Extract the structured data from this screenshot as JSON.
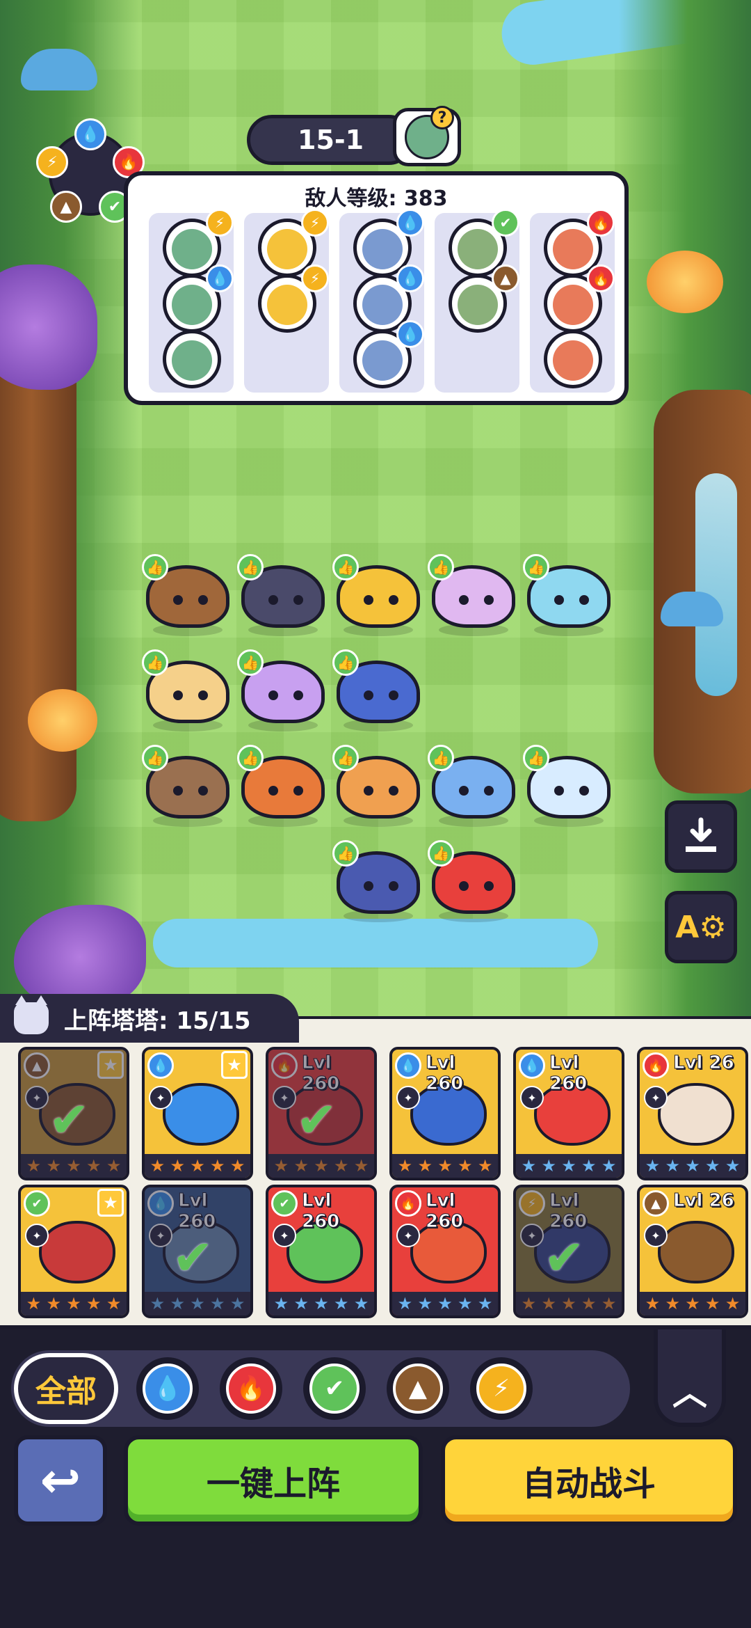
{
  "stage": {
    "label": "15-1",
    "boss_icon": "zombie-question-icon"
  },
  "enemy_panel": {
    "title": "敌人等级: 383",
    "columns": [
      {
        "enemies": [
          {
            "element": "lightning",
            "color": "#f5b21e"
          },
          {
            "element": "water",
            "color": "#3a8ee8"
          },
          {
            "element": "none",
            "color": ""
          }
        ]
      },
      {
        "enemies": [
          {
            "element": "lightning",
            "color": "#f5b21e"
          },
          {
            "element": "lightning",
            "color": "#f5b21e"
          }
        ]
      },
      {
        "enemies": [
          {
            "element": "water",
            "color": "#3a8ee8"
          },
          {
            "element": "water",
            "color": "#3a8ee8"
          },
          {
            "element": "water",
            "color": "#3a8ee8"
          }
        ]
      },
      {
        "enemies": [
          {
            "element": "leaf",
            "color": "#5fc25a"
          },
          {
            "element": "earth",
            "color": "#8a5a2e"
          }
        ]
      },
      {
        "enemies": [
          {
            "element": "fire",
            "color": "#e8363c"
          },
          {
            "element": "fire",
            "color": "#e8363c"
          },
          {
            "element": "none",
            "color": ""
          }
        ]
      }
    ]
  },
  "element_wheel": [
    "water",
    "fire",
    "leaf",
    "earth",
    "lightning"
  ],
  "team_creatures": [
    {
      "name": "shell-tortoise",
      "color": "#a0673a",
      "row": 0,
      "col": 0
    },
    {
      "name": "dino-lizard",
      "color": "#4a4a6a",
      "row": 0,
      "col": 1
    },
    {
      "name": "spiky-lion",
      "color": "#f5c23a",
      "row": 0,
      "col": 2
    },
    {
      "name": "flower-fairy",
      "color": "#e0b8f0",
      "row": 0,
      "col": 3
    },
    {
      "name": "crystal-crab",
      "color": "#8fd8f0",
      "row": 0,
      "col": 4
    },
    {
      "name": "fluffy-dog",
      "color": "#f5d08a",
      "row": 1,
      "col": 0
    },
    {
      "name": "purple-fox",
      "color": "#c8a0f0",
      "row": 1,
      "col": 1
    },
    {
      "name": "flame-fox",
      "color": "#4a6ad0",
      "row": 1,
      "col": 2
    },
    {
      "name": "goggle-ferret",
      "color": "#9a7050",
      "row": 2,
      "col": 0
    },
    {
      "name": "fire-snake",
      "color": "#e87a3a",
      "row": 2,
      "col": 1
    },
    {
      "name": "orange-fox",
      "color": "#f0a050",
      "row": 2,
      "col": 2
    },
    {
      "name": "butterfly-fairy",
      "color": "#7ab0f0",
      "row": 2,
      "col": 3
    },
    {
      "name": "ice-beast",
      "color": "#d8ecff",
      "row": 2,
      "col": 4
    },
    {
      "name": "storm-whale",
      "color": "#4a5ab0",
      "row": 3,
      "col": 2
    },
    {
      "name": "red-dragon",
      "color": "#e8403c",
      "row": 3,
      "col": 3
    }
  ],
  "side_tools": {
    "save_icon": "download-icon",
    "auto_icon": "auto-settings-icon",
    "auto_label": "A⚙"
  },
  "team_header": {
    "label": "上阵塔塔: 15/15"
  },
  "cards": [
    {
      "row": 0,
      "col": 0,
      "bg": "#c89a3a",
      "art": "#8a5a2e",
      "element": "earth",
      "elem_color": "#8a5a2e",
      "elem_glyph": "▲",
      "level": "",
      "fav": true,
      "selected": true,
      "stars": "orange"
    },
    {
      "row": 0,
      "col": 1,
      "bg": "#f5c23a",
      "art": "#3a8ee8",
      "element": "water",
      "elem_color": "#3a8ee8",
      "elem_glyph": "💧",
      "level": "",
      "fav": true,
      "selected": false,
      "stars": "orange"
    },
    {
      "row": 0,
      "col": 2,
      "bg": "#e8403c",
      "art": "#c83a3a",
      "element": "fire",
      "elem_color": "#e8363c",
      "elem_glyph": "🔥",
      "level": "Lvl 260",
      "fav": false,
      "selected": true,
      "stars": "orange"
    },
    {
      "row": 0,
      "col": 3,
      "bg": "#f5c23a",
      "art": "#3a6ad0",
      "element": "water",
      "elem_color": "#3a8ee8",
      "elem_glyph": "💧",
      "level": "Lvl 260",
      "fav": false,
      "selected": false,
      "stars": "orange"
    },
    {
      "row": 0,
      "col": 4,
      "bg": "#f5c23a",
      "art": "#e8403c",
      "element": "water",
      "elem_color": "#3a8ee8",
      "elem_glyph": "💧",
      "level": "Lvl 260",
      "fav": false,
      "selected": false,
      "stars": "blue"
    },
    {
      "row": 0,
      "col": 5,
      "bg": "#f5c23a",
      "art": "#f0e0d0",
      "element": "fire",
      "elem_color": "#e8363c",
      "elem_glyph": "🔥",
      "level": "Lvl 26",
      "fav": false,
      "selected": false,
      "stars": "blue"
    },
    {
      "row": 1,
      "col": 0,
      "bg": "#f5c23a",
      "art": "#c83a3a",
      "element": "leaf",
      "elem_color": "#5fc25a",
      "elem_glyph": "✔",
      "level": "",
      "fav": true,
      "selected": false,
      "stars": "orange"
    },
    {
      "row": 1,
      "col": 1,
      "bg": "#3a5a8a",
      "art": "#6a8ab0",
      "element": "water",
      "elem_color": "#3a8ee8",
      "elem_glyph": "💧",
      "level": "Lvl 260",
      "fav": false,
      "selected": true,
      "stars": "blue"
    },
    {
      "row": 1,
      "col": 2,
      "bg": "#e8403c",
      "art": "#5fc25a",
      "element": "leaf",
      "elem_color": "#5fc25a",
      "elem_glyph": "✔",
      "level": "Lvl 260",
      "fav": false,
      "selected": false,
      "stars": "blue"
    },
    {
      "row": 1,
      "col": 3,
      "bg": "#e8403c",
      "art": "#e85a3a",
      "element": "fire",
      "elem_color": "#e8363c",
      "elem_glyph": "🔥",
      "level": "Lvl 260",
      "fav": false,
      "selected": false,
      "stars": "blue"
    },
    {
      "row": 1,
      "col": 4,
      "bg": "#8a7a3a",
      "art": "#3a4a8a",
      "element": "lightning",
      "elem_color": "#f5b21e",
      "elem_glyph": "⚡",
      "level": "Lvl 260",
      "fav": false,
      "selected": true,
      "stars": "orange"
    },
    {
      "row": 1,
      "col": 5,
      "bg": "#f5c23a",
      "art": "#8a5a2e",
      "element": "earth",
      "elem_color": "#8a5a2e",
      "elem_glyph": "▲",
      "level": "Lvl 26",
      "fav": false,
      "selected": false,
      "stars": "orange"
    }
  ],
  "filters": {
    "all_label": "全部",
    "elements": [
      {
        "name": "water",
        "color": "#3a8ee8",
        "glyph": "💧"
      },
      {
        "name": "fire",
        "color": "#e8363c",
        "glyph": "🔥"
      },
      {
        "name": "leaf",
        "color": "#5fc25a",
        "glyph": "✔"
      },
      {
        "name": "earth",
        "color": "#8a5a2e",
        "glyph": "▲"
      },
      {
        "name": "lightning",
        "color": "#f5b21e",
        "glyph": "⚡"
      }
    ]
  },
  "buttons": {
    "back_glyph": "↩",
    "deploy_label": "一键上阵",
    "auto_battle_label": "自动战斗",
    "collapse_glyph": "︿"
  }
}
